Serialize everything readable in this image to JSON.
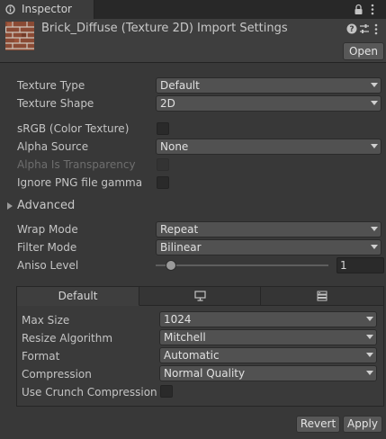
{
  "tab": {
    "title": "Inspector",
    "lock_icon": "lock-icon",
    "menu_icon": "kebab-menu-icon"
  },
  "header": {
    "title": "Brick_Diffuse (Texture 2D) Import Settings",
    "open_label": "Open",
    "icons": [
      "help-icon",
      "preset-icon",
      "kebab-menu-icon"
    ]
  },
  "fields": {
    "texture_type": {
      "label": "Texture Type",
      "value": "Default"
    },
    "texture_shape": {
      "label": "Texture Shape",
      "value": "2D"
    },
    "srgb": {
      "label": "sRGB (Color Texture)",
      "checked": false
    },
    "alpha_source": {
      "label": "Alpha Source",
      "value": "None"
    },
    "alpha_transparency": {
      "label": "Alpha Is Transparency",
      "checked": false,
      "disabled": true
    },
    "ignore_png_gamma": {
      "label": "Ignore PNG file gamma",
      "checked": false
    },
    "advanced": {
      "label": "Advanced",
      "expanded": false
    },
    "wrap_mode": {
      "label": "Wrap Mode",
      "value": "Repeat"
    },
    "filter_mode": {
      "label": "Filter Mode",
      "value": "Bilinear"
    },
    "aniso_level": {
      "label": "Aniso Level",
      "value": "1",
      "level": 1
    }
  },
  "platform": {
    "tabs": [
      {
        "label": "Default",
        "active": true
      },
      {
        "icon": "monitor-icon",
        "active": false
      },
      {
        "icon": "server-icon",
        "active": false
      }
    ],
    "max_size": {
      "label": "Max Size",
      "value": "1024"
    },
    "resize_algorithm": {
      "label": "Resize Algorithm",
      "value": "Mitchell"
    },
    "format": {
      "label": "Format",
      "value": "Automatic"
    },
    "compression": {
      "label": "Compression",
      "value": "Normal Quality"
    },
    "crunch": {
      "label": "Use Crunch Compression",
      "checked": false
    }
  },
  "footer": {
    "revert_label": "Revert",
    "apply_label": "Apply"
  },
  "colors": {
    "background": "#383838",
    "panel": "#3e3e3e",
    "field": "#515151",
    "text": "#c4c4c4"
  }
}
